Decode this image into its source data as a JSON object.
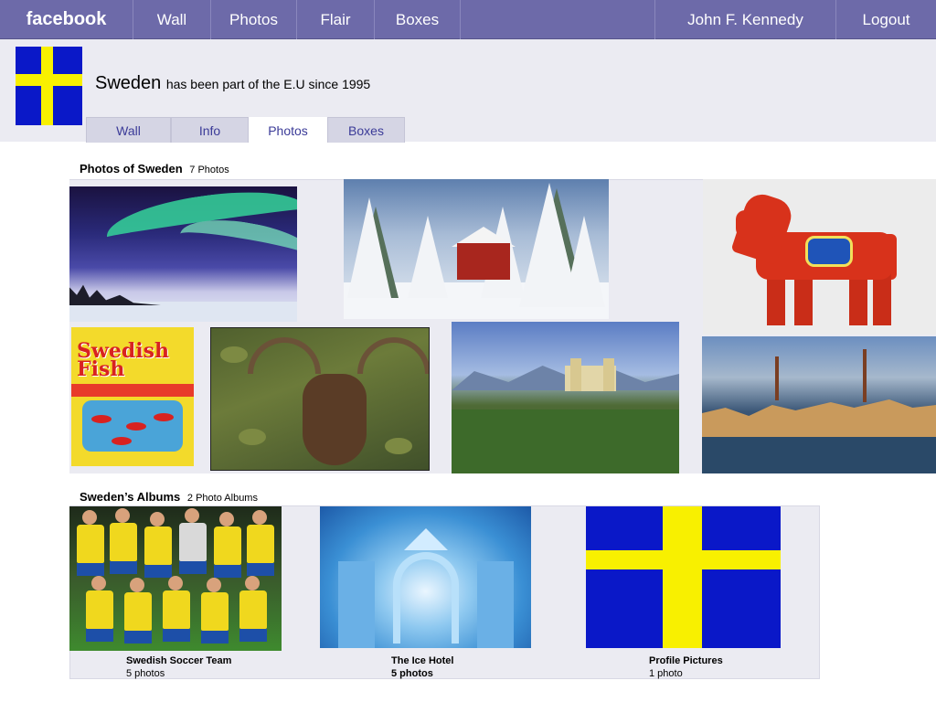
{
  "topbar": {
    "logo": "facebook",
    "nav": [
      "Wall",
      "Photos",
      "Flair",
      "Boxes"
    ],
    "user": "John F. Kennedy",
    "logout": "Logout",
    "bg_color": "#6d6aa9"
  },
  "profile": {
    "name": "Sweden",
    "tagline": "has been part of the E.U since 1995",
    "flag_colors": {
      "blue": "#0a18c8",
      "yellow": "#f8f000"
    },
    "tabs": [
      "Wall",
      "Info",
      "Photos",
      "Boxes"
    ],
    "active_tab": "Photos"
  },
  "photos_section": {
    "title": "Photos of Sweden",
    "count": "7 Photos",
    "photos": [
      {
        "name": "aurora-photo"
      },
      {
        "name": "snow-forest-photo"
      },
      {
        "name": "dala-horse-photo"
      },
      {
        "name": "swedish-fish-photo",
        "package_text": "Swedish Fish"
      },
      {
        "name": "moose-photo"
      },
      {
        "name": "castle-photo"
      },
      {
        "name": "stockholm-photo"
      }
    ]
  },
  "albums_section": {
    "title": "Sweden’s Albums",
    "count": "2 Photo Albums",
    "albums": [
      {
        "name": "Swedish Soccer Team",
        "count": "5 photos"
      },
      {
        "name": "The Ice Hotel",
        "count": "5 photos"
      },
      {
        "name": "Profile Pictures",
        "count": "1 photo"
      }
    ]
  }
}
